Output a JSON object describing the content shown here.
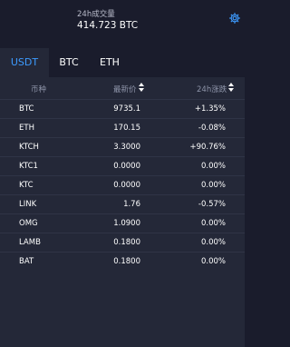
{
  "header": {
    "volume_label": "24h成交量",
    "volume_value": "414.723 BTC",
    "settings_icon": "gear-icon"
  },
  "tabs": [
    {
      "label": "USDT",
      "active": true
    },
    {
      "label": "BTC",
      "active": false
    },
    {
      "label": "ETH",
      "active": false
    }
  ],
  "table": {
    "columns": {
      "coin": "币种",
      "price": "最新价",
      "change": "24h涨跌"
    },
    "rows": [
      {
        "coin": "BTC",
        "price": "9735.1",
        "change": "+1.35%"
      },
      {
        "coin": "ETH",
        "price": "170.15",
        "change": "-0.08%"
      },
      {
        "coin": "KTCH",
        "price": "3.3000",
        "change": "+90.76%"
      },
      {
        "coin": "KTC1",
        "price": "0.0000",
        "change": "0.00%"
      },
      {
        "coin": "KTC",
        "price": "0.0000",
        "change": "0.00%"
      },
      {
        "coin": "LINK",
        "price": "1.76",
        "change": "-0.57%"
      },
      {
        "coin": "OMG",
        "price": "1.0900",
        "change": "0.00%"
      },
      {
        "coin": "LAMB",
        "price": "0.1800",
        "change": "0.00%"
      },
      {
        "coin": "BAT",
        "price": "0.1800",
        "change": "0.00%"
      }
    ]
  },
  "colors": {
    "accent": "#3d9bff",
    "background": "#1a1c2c",
    "panel": "#242838"
  }
}
